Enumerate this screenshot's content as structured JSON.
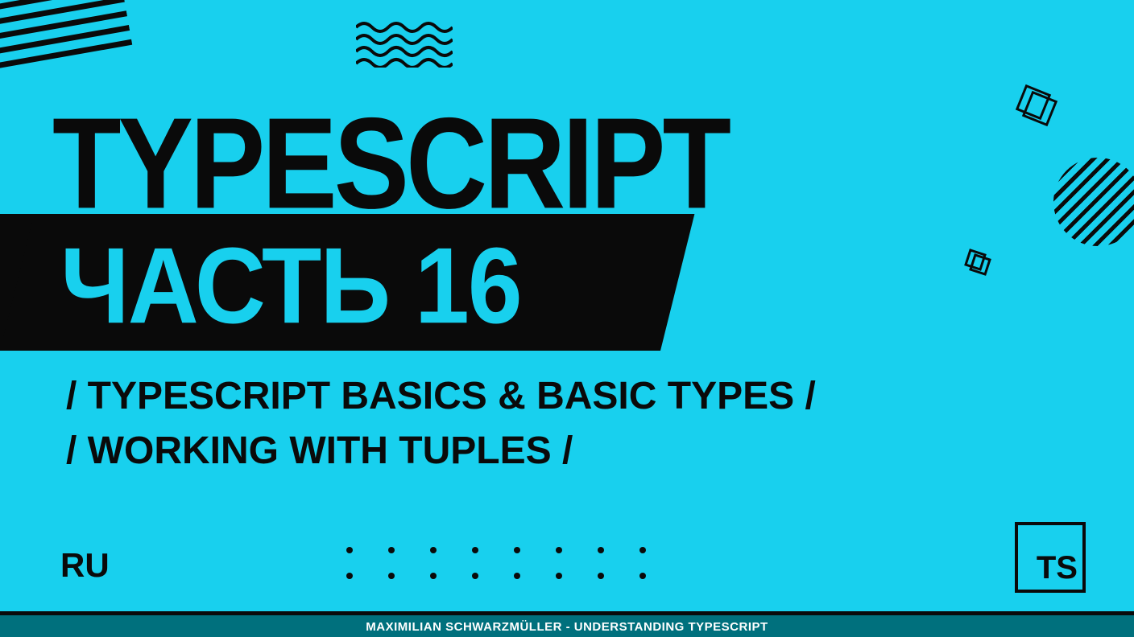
{
  "title": "TYPESCRIPT",
  "part_label": "ЧАСТЬ 16",
  "subtitle_line1": "/ TYPESCRIPT BASICS & BASIC TYPES /",
  "subtitle_line2": "/ WORKING WITH TUPLES /",
  "language_badge": "RU",
  "logo_text": "TS",
  "footer": "MAXIMILIAN SCHWARZMÜLLER - UNDERSTANDING TYPESCRIPT",
  "colors": {
    "background": "#18d0ee",
    "accent_dark": "#0a0a0a",
    "footer_bg": "#00707d"
  }
}
